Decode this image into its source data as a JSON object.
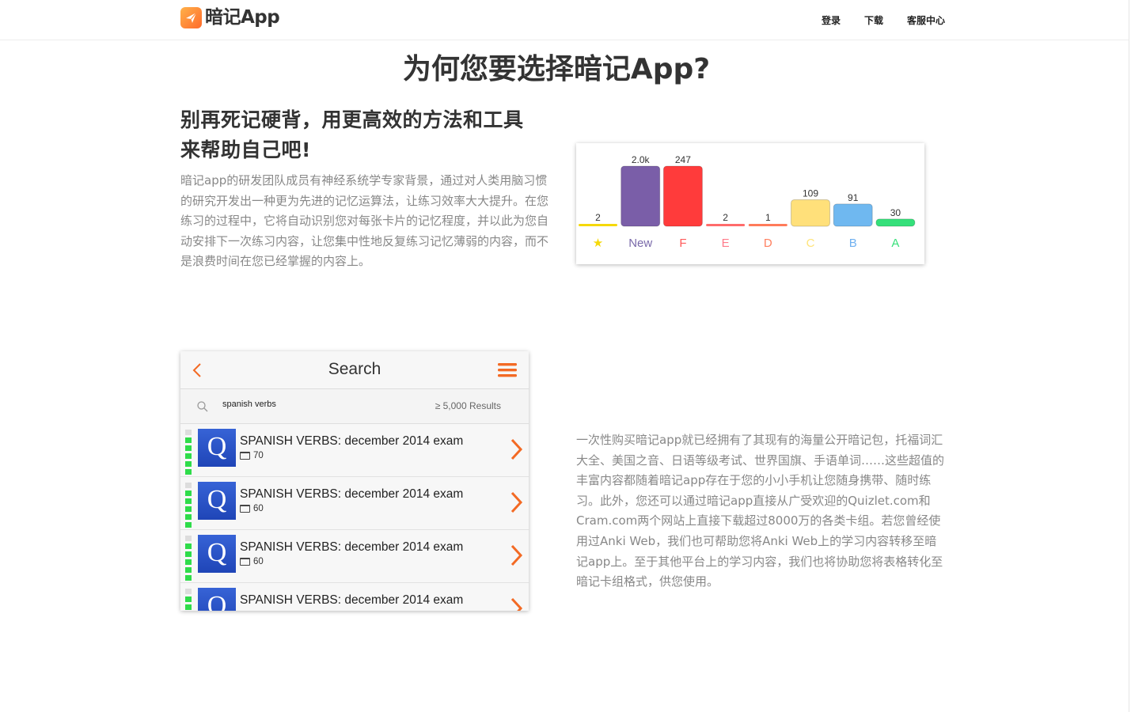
{
  "header": {
    "logo_text": "暗记App",
    "logo_icon": "paper-plane-icon",
    "nav": [
      "登录",
      "下载",
      "客服中心"
    ]
  },
  "main_title": "为何您要选择暗记App?",
  "section1": {
    "heading_line1": "别再死记硬背，用更高效的方法和工具",
    "heading_line2": "来帮助自己吧!",
    "body": "暗记app的研发团队成员有神经系统学专家背景，通过对人类用脑习惯的研究开发出一种更为先进的记忆运算法，让练习效率大大提升。在您练习的过程中，它将自动识别您对每张卡片的记忆程度，并以此为您自动安排下一次练习内容，让您集中性地反复练习记忆薄弱的内容，而不是浪费时间在您已经掌握的内容上。"
  },
  "stats": {
    "labels": [
      "★",
      "New",
      "F",
      "E",
      "D",
      "C",
      "B",
      "A"
    ],
    "display_values": [
      "2",
      "2.0k",
      "247",
      "2",
      "1",
      "109",
      "91",
      "30"
    ],
    "bar_levels": [
      0.02,
      1.0,
      1.0,
      0.02,
      0.02,
      0.44,
      0.37,
      0.12
    ],
    "colors": [
      "#f5d90a",
      "#7a5ea8",
      "#ff3b3b",
      "#ff6b6b",
      "#ff7b5a",
      "#ffe07a",
      "#6fb8f0",
      "#35e07a"
    ],
    "label_colors": [
      "#f5d90a",
      "#7a6aaa",
      "#ff5a5a",
      "#ff7b8a",
      "#ff8060",
      "#ffe47a",
      "#6fb0f0",
      "#38e07a"
    ]
  },
  "phone": {
    "title": "Search",
    "search_value": "spanish verbs",
    "results": "≥ 5,000 Results",
    "rows": [
      {
        "title": "SPANISH VERBS: december 2014 exam",
        "count": "70"
      },
      {
        "title": "SPANISH VERBS: december 2014 exam",
        "count": "60"
      },
      {
        "title": "SPANISH VERBS: december 2014 exam",
        "count": "60"
      },
      {
        "title": "SPANISH VERBS: december 2014 exam",
        "count": ""
      }
    ],
    "logo_letter": "Q"
  },
  "section2": {
    "body": "一次性购买暗记app就已经拥有了其现有的海量公开暗记包，托福词汇大全、美国之音、日语等级考试、世界国旗、手语单词……这些超值的丰富内容都随着暗记app存在于您的小小手机让您随身携带、随时练习。此外，您还可以通过暗记app直接从广受欢迎的Quizlet.com和Cram.com两个网站上直接下载超过8000万的各类卡组。若您曾经使用过Anki Web，我们也可帮助您将Anki Web上的学习内容转移至暗记app上。至于其他平台上的学习内容，我们也将协助您将表格转化至暗记卡组格式，供您使用。"
  }
}
